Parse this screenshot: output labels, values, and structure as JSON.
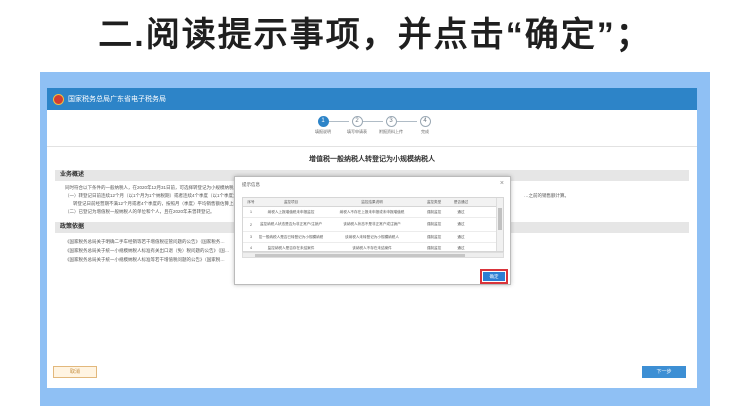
{
  "headline": "二.阅读提示事项，并点击“确定”；",
  "app": {
    "title": "国家税务总局广东省电子税务局"
  },
  "stepper": [
    {
      "num": "1",
      "label": "填报说明"
    },
    {
      "num": "2",
      "label": "填写申请表"
    },
    {
      "num": "3",
      "label": "附报资料上传"
    },
    {
      "num": "4",
      "label": "完成"
    }
  ],
  "doc_title": "增值税一般纳税人转登记为小规模纳税人",
  "section1": {
    "title": "业务概述",
    "lines": [
      "同时符合以下条件的一般纳税人，在2020年12月31日前，可选择转登记为小规模纳税人：",
      "（一）转登记日前连续12个月（以1个月为1个纳税期）或者连续4个季度（以1个季度为1个纳税期）累计销售额未超过500万元；",
      "转登记日前经营期不满12个月或者4个季度的，按照月（季度）平均销售额估算上款规定的累计销售额。",
      "（二）已登记为增值税一般纳税人的单位和个人，且在2020年未曾转登记。"
    ],
    "trail": "…之前的销售额计算。"
  },
  "section2": {
    "title": "政策依据",
    "lines": [
      "《国家税务总局关于明确二手车经销等若干增值税征管问题的公告》（国家税务…",
      "《国家税务总局关于统一小规模纳税人标准有关出口退（免）税问题的公告》（国…",
      "《国家税务总局关于统一小规模纳税人标准等若干增值税问题的公告》（国家税…"
    ]
  },
  "buttons": {
    "cancel": "取消",
    "next": "下一步"
  },
  "modal": {
    "title": "提示信息",
    "close": "×",
    "columns": [
      "序号",
      "监控项目",
      "监控结果说明",
      "监控类型",
      "是否通过"
    ],
    "rows": [
      [
        "1",
        "纳税人上报增值税未申报监控",
        "纳税人不存在上报未申报或未申报增值税",
        "强制监控",
        "通过"
      ],
      [
        "2",
        "监控纳税人状态是否为非正常户/注销户",
        "该纳税人状态不是非正常户或注销户",
        "强制监控",
        "通过"
      ],
      [
        "3",
        "监控一般纳税人是否已转登记为小规模纳税人",
        "该纳税人未转登记为小规模纳税人",
        "强制监控",
        "通过"
      ],
      [
        "4",
        "监控纳税人是否存在未结案件",
        "该纳税人不存在未结案件",
        "强制监控",
        "通过"
      ]
    ],
    "ok": "确定"
  }
}
